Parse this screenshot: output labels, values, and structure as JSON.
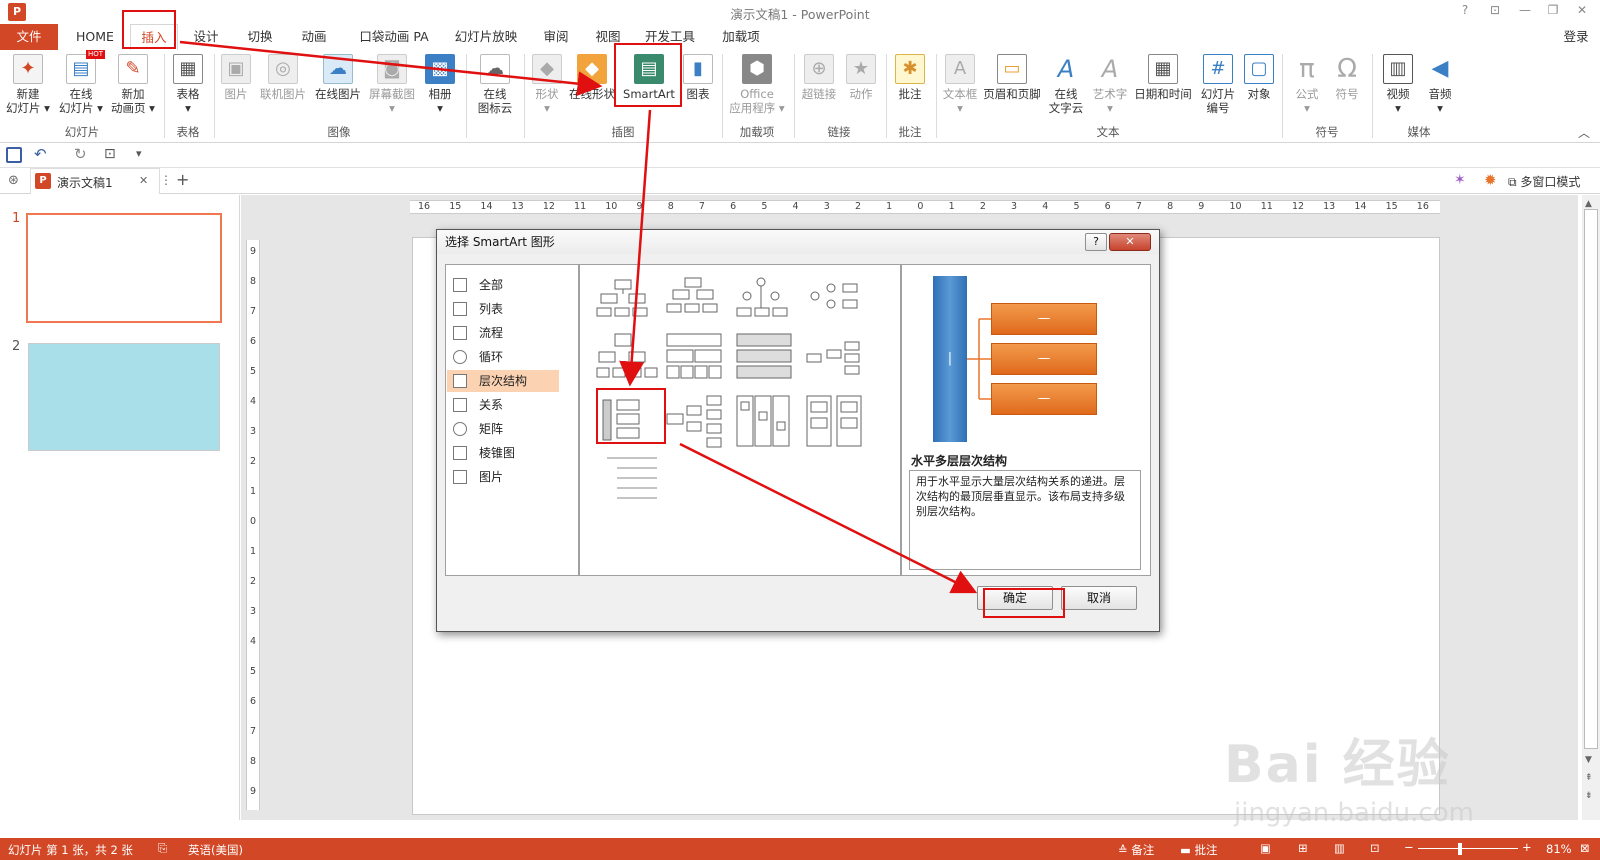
{
  "window": {
    "title": "演示文稿1 - PowerPoint",
    "login": "登录",
    "help": "?",
    "controls": [
      "?",
      "⊡",
      "—",
      "❐",
      "✕"
    ]
  },
  "tabs": [
    {
      "label": "文件"
    },
    {
      "label": "HOME"
    },
    {
      "label": "插入"
    },
    {
      "label": "设计"
    },
    {
      "label": "切换"
    },
    {
      "label": "动画"
    },
    {
      "label": "口袋动画 PA"
    },
    {
      "label": "幻灯片放映"
    },
    {
      "label": "审阅"
    },
    {
      "label": "视图"
    },
    {
      "label": "开发工具"
    },
    {
      "label": "加载项"
    }
  ],
  "ribbon": {
    "groups": [
      {
        "label": "幻灯片",
        "buttons": [
          {
            "label": "新建\n幻灯片 ▾",
            "icon": "new-slide-icon"
          },
          {
            "label": "在线\n幻灯片 ▾",
            "icon": "online-slide-icon",
            "badge": "HOT"
          },
          {
            "label": "新加\n动画页 ▾",
            "icon": "add-animation-page-icon"
          }
        ]
      },
      {
        "label": "表格",
        "buttons": [
          {
            "label": "表格\n▾",
            "icon": "table-icon"
          }
        ]
      },
      {
        "label": "图像",
        "buttons": [
          {
            "label": "图片",
            "icon": "picture-icon",
            "disabled": true
          },
          {
            "label": "联机图片",
            "icon": "online-picture-icon",
            "disabled": true
          },
          {
            "label": "在线图片",
            "icon": "online-image-icon"
          },
          {
            "label": "屏幕截图\n▾",
            "icon": "screenshot-icon",
            "disabled": true
          },
          {
            "label": "相册\n▾",
            "icon": "album-icon"
          }
        ]
      },
      {
        "label": "",
        "buttons": [
          {
            "label": "在线\n图标云",
            "icon": "icon-cloud-icon"
          }
        ]
      },
      {
        "label": "插图",
        "buttons": [
          {
            "label": "形状\n▾",
            "icon": "shapes-icon",
            "disabled": true
          },
          {
            "label": "在线形状",
            "icon": "online-shapes-icon"
          },
          {
            "label": "SmartArt",
            "icon": "smartart-icon"
          },
          {
            "label": "图表",
            "icon": "chart-icon"
          }
        ]
      },
      {
        "label": "加载项",
        "buttons": [
          {
            "label": "Office\n应用程序 ▾",
            "icon": "office-apps-icon",
            "disabled": true
          }
        ]
      },
      {
        "label": "链接",
        "buttons": [
          {
            "label": "超链接",
            "icon": "hyperlink-icon",
            "disabled": true
          },
          {
            "label": "动作",
            "icon": "action-icon",
            "disabled": true
          }
        ]
      },
      {
        "label": "批注",
        "buttons": [
          {
            "label": "批注",
            "icon": "comment-icon"
          }
        ]
      },
      {
        "label": "文本",
        "buttons": [
          {
            "label": "文本框\n▾",
            "icon": "textbox-icon",
            "disabled": true
          },
          {
            "label": "页眉和页脚",
            "icon": "header-footer-icon"
          },
          {
            "label": "在线\n文字云",
            "icon": "word-cloud-icon"
          },
          {
            "label": "艺术字\n▾",
            "icon": "wordart-icon",
            "disabled": true
          },
          {
            "label": "日期和时间",
            "icon": "datetime-icon"
          },
          {
            "label": "幻灯片\n编号",
            "icon": "slide-number-icon"
          },
          {
            "label": "对象",
            "icon": "object-icon"
          }
        ]
      },
      {
        "label": "符号",
        "buttons": [
          {
            "label": "公式\n▾",
            "icon": "equation-icon",
            "disabled": true
          },
          {
            "label": "符号",
            "icon": "symbol-icon",
            "disabled": true
          }
        ]
      },
      {
        "label": "媒体",
        "buttons": [
          {
            "label": "视频\n▾",
            "icon": "video-icon"
          },
          {
            "label": "音频\n▾",
            "icon": "audio-icon"
          }
        ]
      }
    ]
  },
  "qat": {
    "items": [
      "save-icon",
      "undo-icon",
      "redo-icon",
      "slideshow-icon",
      "customize-icon"
    ]
  },
  "doctabs": {
    "file": "演示文稿1",
    "close": "✕",
    "more": "⋮",
    "add": "+",
    "multiwindow": "多窗口模式"
  },
  "ruler": {
    "h": [
      "16",
      "15",
      "14",
      "13",
      "12",
      "11",
      "10",
      "9",
      "8",
      "7",
      "6",
      "5",
      "4",
      "3",
      "2",
      "1",
      "0",
      "1",
      "2",
      "3",
      "4",
      "5",
      "6",
      "7",
      "8",
      "9",
      "10",
      "11",
      "12",
      "13",
      "14",
      "15",
      "16"
    ],
    "v": [
      "9",
      "8",
      "7",
      "6",
      "5",
      "4",
      "3",
      "2",
      "1",
      "0",
      "1",
      "2",
      "3",
      "4",
      "5",
      "6",
      "7",
      "8",
      "9"
    ]
  },
  "slides": [
    {
      "num": "1"
    },
    {
      "num": "2"
    }
  ],
  "dialog": {
    "title": "选择 SmartArt 图形",
    "help": "?",
    "close": "✕",
    "categories": [
      "全部",
      "列表",
      "流程",
      "循环",
      "层次结构",
      "关系",
      "矩阵",
      "棱锥图",
      "图片"
    ],
    "selected_category": "层次结构",
    "preview_title": "水平多层层次结构",
    "preview_desc": "用于水平显示大量层次结构关系的递进。层次结构的最顶层垂直显示。该布局支持多级别层次结构。",
    "preview_box_text": "—",
    "preview_bar_text": "|",
    "ok": "确定",
    "cancel": "取消"
  },
  "status": {
    "slide": "幻灯片 第 1 张，共 2 张",
    "lang": "英语(美国)",
    "notes": "备注",
    "comments": "批注",
    "zoom": "81%"
  },
  "watermark": {
    "text": "Bai 经验",
    "url": "jingyan.baidu.com"
  },
  "colors": {
    "accent": "#d24726",
    "highlight": "#e01010",
    "orange": "#e8742a",
    "blue": "#3b7fc4"
  }
}
